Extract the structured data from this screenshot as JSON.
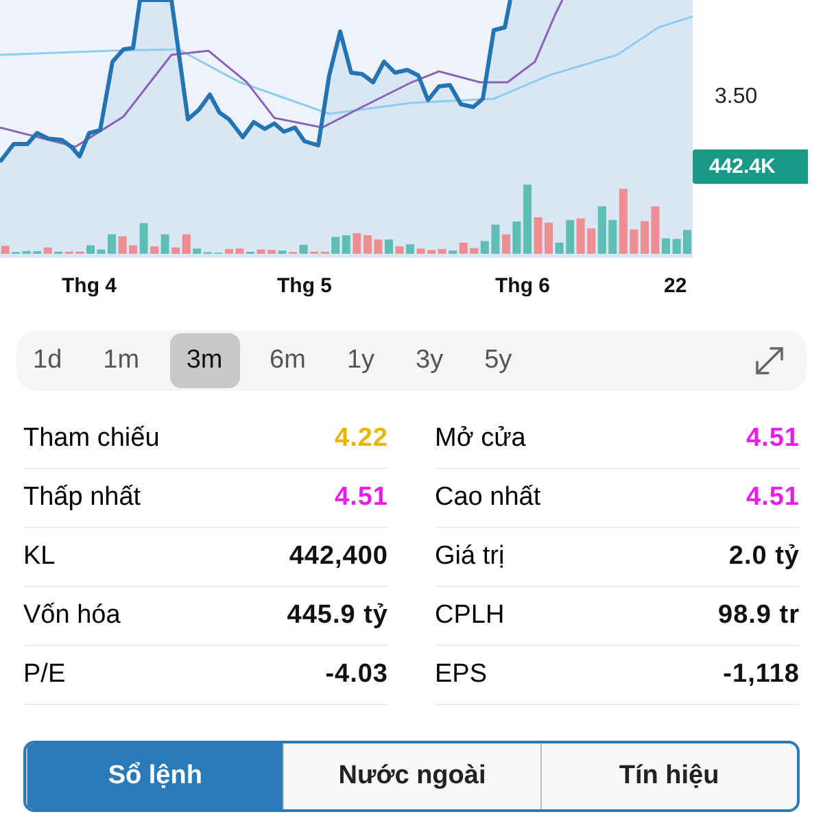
{
  "chart": {
    "price_tick": "3.50",
    "volume_badge": "442.4K",
    "x_labels": [
      "Thg 4",
      "Thg 5",
      "Thg 6",
      "22"
    ]
  },
  "periods": [
    {
      "label": "1d",
      "selected": false
    },
    {
      "label": "1m",
      "selected": false
    },
    {
      "label": "3m",
      "selected": true
    },
    {
      "label": "6m",
      "selected": false
    },
    {
      "label": "1y",
      "selected": false
    },
    {
      "label": "3y",
      "selected": false
    },
    {
      "label": "5y",
      "selected": false
    }
  ],
  "stats": [
    {
      "label": "Tham chiếu",
      "value": "4.22",
      "color": "#e8b400"
    },
    {
      "label": "Mở cửa",
      "value": "4.51",
      "color": "#e61ee6"
    },
    {
      "label": "Thấp nhất",
      "value": "4.51",
      "color": "#e61ee6"
    },
    {
      "label": "Cao nhất",
      "value": "4.51",
      "color": "#e61ee6"
    },
    {
      "label": "KL",
      "value": "442,400",
      "color": "#111111"
    },
    {
      "label": "Giá trị",
      "value": "2.0 tỷ",
      "color": "#111111"
    },
    {
      "label": "Vốn hóa",
      "value": "445.9 tỷ",
      "color": "#111111"
    },
    {
      "label": "CPLH",
      "value": "98.9 tr",
      "color": "#111111"
    },
    {
      "label": "P/E",
      "value": "-4.03",
      "color": "#111111"
    },
    {
      "label": "EPS",
      "value": "-1,118",
      "color": "#111111"
    }
  ],
  "tabs": [
    {
      "label": "Sổ lệnh",
      "selected": true
    },
    {
      "label": "Nước ngoài",
      "selected": false
    },
    {
      "label": "Tín hiệu",
      "selected": false
    }
  ]
}
